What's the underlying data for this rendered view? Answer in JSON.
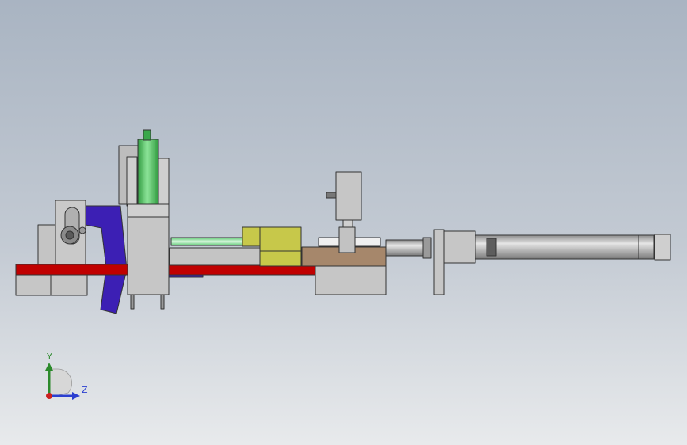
{
  "viewport": {
    "background_top": "#a9b4c2",
    "background_bottom": "#e8eaec"
  },
  "model": {
    "colors": {
      "steel": "#c4c4c4",
      "steel_dark": "#9a9a9a",
      "red_rail": "#c00000",
      "blue_bracket": "#3c1fb4",
      "green_cylinder": "#52c65e",
      "green_rod": "#8fe3a0",
      "yellow_block": "#c7c84a",
      "brown_plate": "#a6876b",
      "shaft": "#bcbcbc"
    }
  },
  "triad": {
    "y_label": "Y",
    "z_label": "Z",
    "y_color": "#2c8a2c",
    "z_color": "#2b3fd0",
    "origin_color": "#cc2020"
  }
}
